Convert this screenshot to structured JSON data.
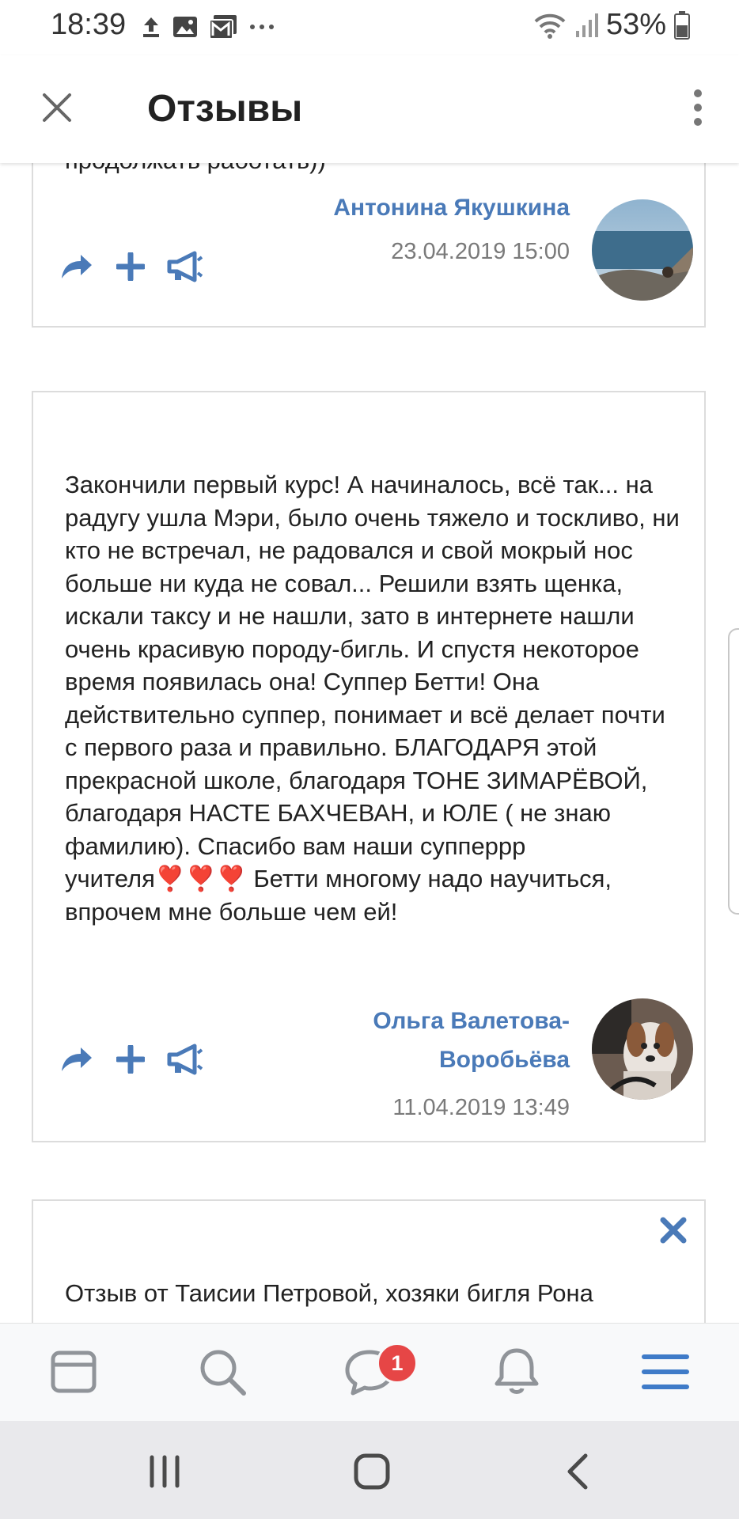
{
  "status_bar": {
    "time": "18:39",
    "battery": "53%",
    "left_icons": [
      "upload-icon",
      "image-icon",
      "gallery-icon",
      "more-dots-icon"
    ],
    "right_icons": [
      "wifi-icon",
      "signal-icon",
      "battery-icon"
    ]
  },
  "header": {
    "title": "Отзывы",
    "close_icon": "close-icon",
    "menu_icon": "more-vertical-icon"
  },
  "reviews": [
    {
      "text": "продолжать работать))",
      "author": "Антонина Якушкина",
      "date": "23.04.2019 15:00"
    },
    {
      "text": "Закончили первый курс! А начиналось, всё так... на радугу ушла Мэри, было очень тяжело и тоскливо, ни кто не встречал, не радовался и свой мокрый нос больше ни куда не совал... Решили взять щенка, искали таксу и не нашли, зато в интернете нашли очень красивую породу-бигль. И спустя некоторое время появилась она! Суппер Бетти! Она действительно суппер, понимает и всё делает почти с первого раза и правильно. БЛАГОДАРЯ этой прекрасной школе, благодаря ТОНЕ ЗИМАРЁВОЙ, благодаря НАСТЕ БАХЧЕВАН, и ЮЛЕ ( не знаю фамилию). Спасибо вам наши супперрр учителя❣️❣️❣️ Бетти многому надо научиться, впрочем мне больше чем ей!",
      "author": "Ольга Валетова-Воробьёва",
      "date": "11.04.2019 13:49"
    },
    {
      "text": "Отзыв от Таисии Петровой, хозяки бигля Рона"
    }
  ],
  "actions": [
    "share-icon",
    "add-icon",
    "megaphone-icon"
  ],
  "bottom_nav": {
    "tabs": [
      "feed-icon",
      "search-icon",
      "messages-icon",
      "notifications-icon",
      "menu-icon"
    ],
    "messages_badge": "1",
    "accent": "#3f7bc8"
  },
  "system_nav": [
    "recent-apps-icon",
    "home-icon",
    "back-icon"
  ]
}
